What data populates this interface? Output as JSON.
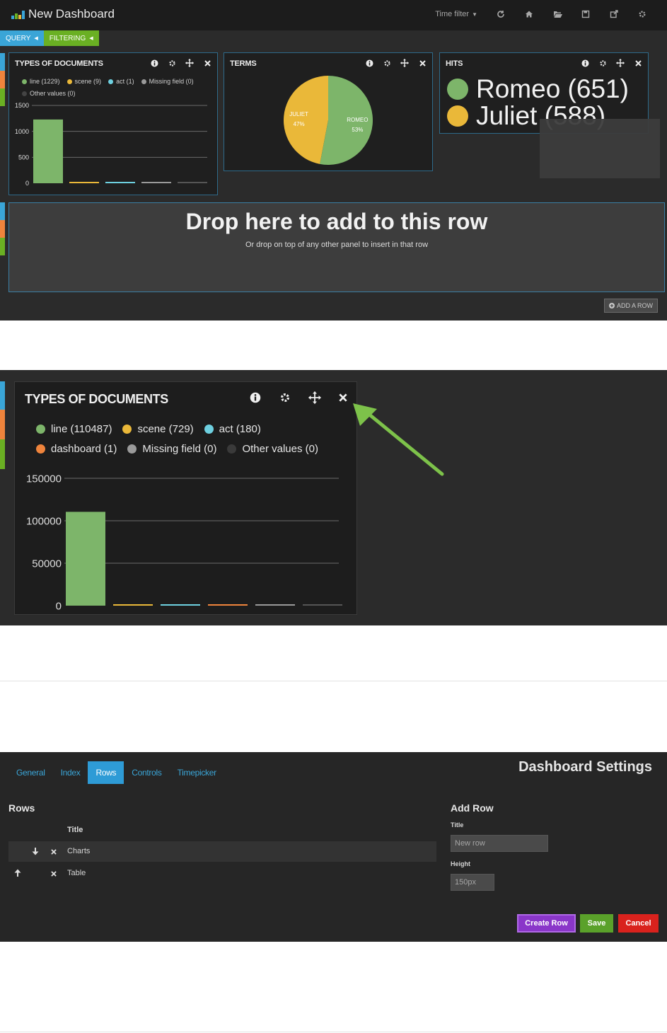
{
  "colors": {
    "green": "#7db56a",
    "yellow": "#eab839",
    "blue": "#6ed0e0",
    "orange": "#ef843c",
    "gray": "#9a9a9a",
    "dark_gray": "#555555",
    "accent_blue": "#3aa5d7",
    "accent_green": "#6ab023",
    "purple": "#9a3bdb",
    "red": "#d9221d"
  },
  "screenshot1": {
    "navbar": {
      "title": "New Dashboard",
      "time_filter": "Time filter",
      "icons": [
        "refresh-icon",
        "home-icon",
        "folder-open-icon",
        "save-icon",
        "share-icon",
        "gear-icon"
      ]
    },
    "subnav": {
      "query": "QUERY",
      "filtering": "FILTERING"
    },
    "types_panel": {
      "title": "TYPES OF DOCUMENTS",
      "legend": [
        "line (1229)",
        "scene (9)",
        "act (1)",
        "Missing field (0)",
        "Other values (0)"
      ],
      "y_ticks": [
        "1500",
        "1000",
        "500",
        "0"
      ]
    },
    "terms_panel": {
      "title": "TERMS",
      "slices": [
        {
          "label": "JULIET",
          "pct": "47%"
        },
        {
          "label": "ROMEO",
          "pct": "53%"
        }
      ]
    },
    "hits_panel": {
      "title": "HITS",
      "items": [
        "Romeo (651)",
        "Juliet (588)"
      ]
    },
    "drop_zone": {
      "title": "Drop here to add to this row",
      "subtitle": "Or drop on top of any other panel to insert in that row"
    },
    "add_row_button": "ADD A ROW"
  },
  "screenshot2": {
    "panel": {
      "title": "TYPES OF DOCUMENTS",
      "legend_row1": [
        "line (110487)",
        "scene (729)",
        "act (180)"
      ],
      "legend_row2": [
        "dashboard (1)",
        "Missing field (0)",
        "Other values (0)"
      ],
      "y_ticks": [
        "150000",
        "100000",
        "50000",
        "0"
      ]
    }
  },
  "screenshot3": {
    "tabs": [
      "General",
      "Index",
      "Rows",
      "Controls",
      "Timepicker"
    ],
    "active_tab": "Rows",
    "settings_title": "Dashboard Settings",
    "rows_heading": "Rows",
    "title_column": "Title",
    "rows": [
      "Charts",
      "Table"
    ],
    "add_row": {
      "heading": "Add Row",
      "title_label": "Title",
      "title_value": "New row",
      "height_label": "Height",
      "height_value": "150px"
    },
    "buttons": {
      "create": "Create Row",
      "save": "Save",
      "cancel": "Cancel"
    }
  },
  "chart_data": [
    {
      "type": "bar",
      "title": "TYPES OF DOCUMENTS",
      "categories": [
        "line",
        "scene",
        "act",
        "Missing field",
        "Other values"
      ],
      "values": [
        1229,
        9,
        1,
        0,
        0
      ],
      "ylim": [
        0,
        1500
      ],
      "grid": true,
      "legend": "top"
    },
    {
      "type": "pie",
      "title": "TERMS",
      "categories": [
        "JULIET",
        "ROMEO"
      ],
      "values": [
        47,
        53
      ]
    },
    {
      "type": "bar",
      "title": "TYPES OF DOCUMENTS",
      "categories": [
        "line",
        "scene",
        "act",
        "dashboard",
        "Missing field",
        "Other values"
      ],
      "values": [
        110487,
        729,
        180,
        1,
        0,
        0
      ],
      "ylim": [
        0,
        150000
      ],
      "grid": true,
      "legend": "top"
    }
  ]
}
